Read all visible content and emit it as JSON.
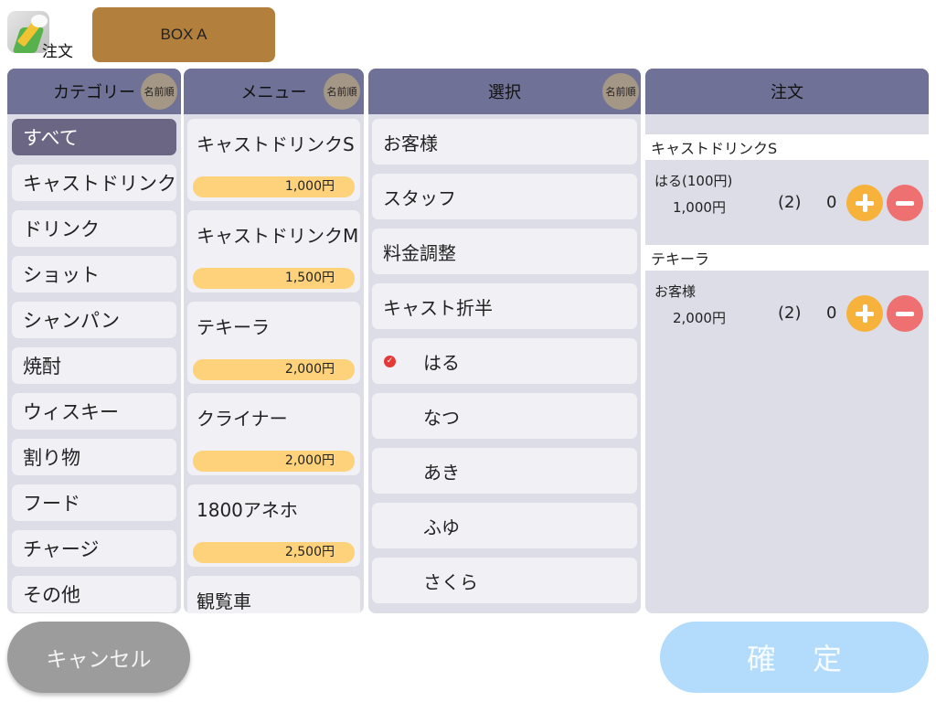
{
  "app": {
    "icon_label": "注文",
    "box_name": "BOX A"
  },
  "category_panel": {
    "title": "カテゴリー",
    "sort_label": "名前順",
    "items": [
      "すべて",
      "キャストドリンク",
      "ドリンク",
      "ショット",
      "シャンパン",
      "焼酎",
      "ウィスキー",
      "割り物",
      "フード",
      "チャージ",
      "その他"
    ],
    "selected_index": 0
  },
  "menu_panel": {
    "title": "メニュー",
    "sort_label": "名前順",
    "items": [
      {
        "name": "キャストドリンクS",
        "price": "1,000円"
      },
      {
        "name": "キャストドリンクM",
        "price": "1,500円"
      },
      {
        "name": "テキーラ",
        "price": "2,000円"
      },
      {
        "name": "クライナー",
        "price": "2,000円"
      },
      {
        "name": "1800アネホ",
        "price": "2,500円"
      },
      {
        "name": "観覧車",
        "price": ""
      }
    ]
  },
  "select_panel": {
    "title": "選択",
    "sort_label": "名前順",
    "items": [
      "お客様",
      "スタッフ",
      "料金調整",
      "キャスト折半",
      "はる",
      "なつ",
      "あき",
      "ふゆ",
      "さくら"
    ],
    "checked_item": "はる"
  },
  "order_panel": {
    "title": "注文",
    "groups": [
      {
        "title": "キャストドリンクS",
        "who": "はる(100円)",
        "amount": "1,000円",
        "qty": "(2)",
        "count": "0"
      },
      {
        "title": "テキーラ",
        "who": "お客様",
        "amount": "2,000円",
        "qty": "(2)",
        "count": "0"
      }
    ]
  },
  "buttons": {
    "cancel": "キャンセル",
    "confirm": "確定"
  },
  "colors": {
    "header": "#6f7296",
    "panel_bg": "#dcdde7",
    "selected_category": "#6b6683",
    "price_pill": "#fdd27a",
    "plus": "#f6b23b",
    "minus": "#ef7070",
    "cancel": "#9c9c9c",
    "confirm": "#b3dcfc",
    "box": "#b27f3d"
  }
}
